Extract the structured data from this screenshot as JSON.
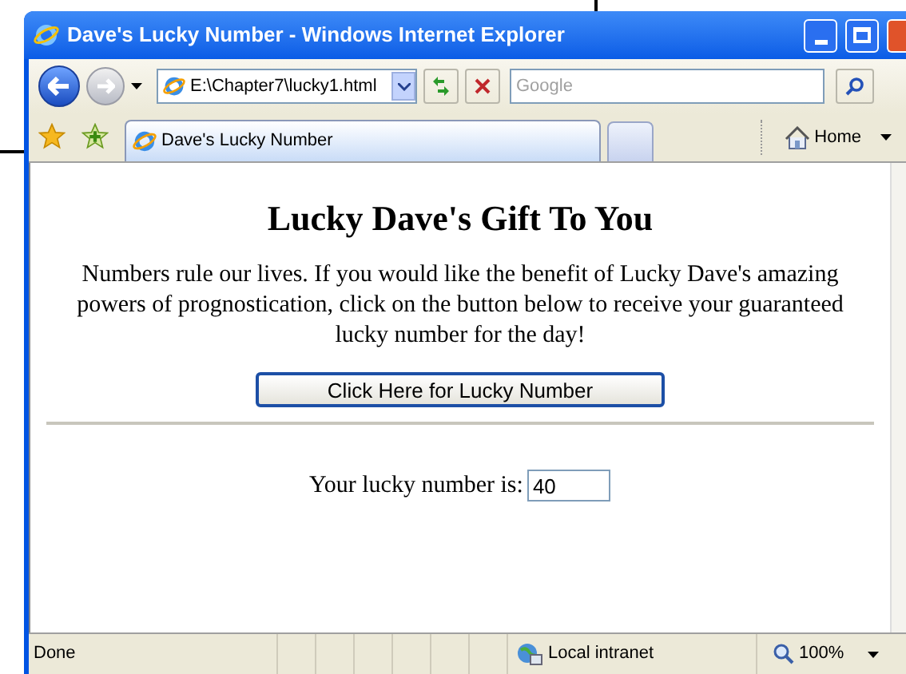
{
  "window": {
    "title": "Dave's Lucky Number - Windows Internet Explorer"
  },
  "toolbar": {
    "address": "E:\\Chapter7\\lucky1.html",
    "search": {
      "placeholder": "Google"
    }
  },
  "tabs": [
    {
      "label": "Dave's Lucky Number",
      "selected": true
    }
  ],
  "command_bar": {
    "home": "Home"
  },
  "page": {
    "heading": "Lucky Dave's Gift To You",
    "paragraph": "Numbers rule our lives. If you would like the benefit of Lucky Dave's amazing powers of prognostication, click on the button below to receive your guaranteed lucky number for the day!",
    "button": "Click Here for Lucky Number",
    "result_label": "Your lucky number is:",
    "result_value": "40"
  },
  "status_bar": {
    "text": "Done",
    "zone": "Local intranet",
    "zoom": "100%"
  }
}
